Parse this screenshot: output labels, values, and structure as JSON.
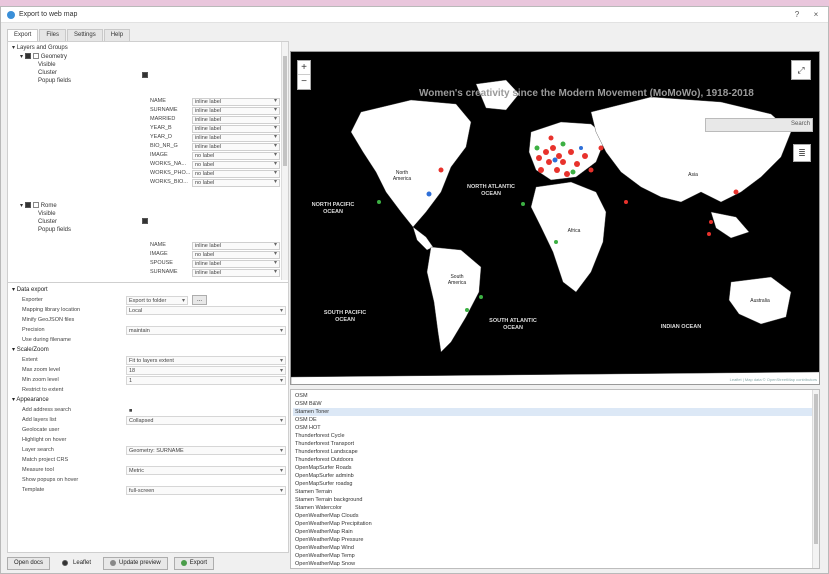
{
  "window": {
    "title": "Export to web map",
    "help_btn": "?",
    "close_btn": "×"
  },
  "tabs": [
    {
      "label": "Export"
    },
    {
      "label": "Files"
    },
    {
      "label": "Settings"
    },
    {
      "label": "Help"
    }
  ],
  "layers_tree": {
    "header": "Layers and Groups",
    "layer1": {
      "name": "Geometry",
      "options": [
        "Visible",
        "Cluster",
        "Popup fields"
      ],
      "fields": [
        {
          "name": "NAME",
          "value": "inline label"
        },
        {
          "name": "SURNAME",
          "value": "inline label"
        },
        {
          "name": "MARRIED",
          "value": "inline label"
        },
        {
          "name": "YEAR_B",
          "value": "inline label"
        },
        {
          "name": "YEAR_D",
          "value": "inline label"
        },
        {
          "name": "BIO_NR_G",
          "value": "inline label"
        },
        {
          "name": "IMAGE",
          "value": "no label"
        },
        {
          "name": "WORKS_NA...",
          "value": "no label"
        },
        {
          "name": "WORKS_PHO...",
          "value": "no label"
        },
        {
          "name": "WORKS_BIO...",
          "value": "no label"
        }
      ]
    },
    "layer2": {
      "name": "Rome",
      "options": [
        "Visible",
        "Cluster",
        "Popup fields"
      ],
      "fields": [
        {
          "name": "NAME",
          "value": "inline label"
        },
        {
          "name": "IMAGE",
          "value": "no label"
        },
        {
          "name": "SPOUSE",
          "value": "inline label"
        },
        {
          "name": "SURNAME",
          "value": "inline label"
        }
      ]
    }
  },
  "properties": {
    "data_export": {
      "header": "Data export",
      "rows": [
        {
          "name": "Exporter",
          "value": "Export to folder"
        },
        {
          "name": "Mapping library location",
          "value": "Local"
        },
        {
          "name": "Minify GeoJSON files",
          "value": ""
        },
        {
          "name": "Precision",
          "value": "maintain"
        },
        {
          "name": "Use during filename",
          "value": ""
        }
      ],
      "browse_btn": "..."
    },
    "scale_zoom": {
      "header": "Scale/Zoom",
      "rows": [
        {
          "name": "Extent",
          "value": "Fit to layers extent"
        },
        {
          "name": "Max zoom level",
          "value": "18"
        },
        {
          "name": "Min zoom level",
          "value": "1"
        },
        {
          "name": "Restrict to extent",
          "value": ""
        }
      ]
    },
    "appearance": {
      "header": "Appearance",
      "rows": [
        {
          "name": "Add address search",
          "value": "■"
        },
        {
          "name": "Add layers list",
          "value": "Collapsed"
        },
        {
          "name": "Geolocate user",
          "value": ""
        },
        {
          "name": "Highlight on hover",
          "value": ""
        },
        {
          "name": "Layer search",
          "value": "Geometry: SURNAME"
        },
        {
          "name": "Match project CRS",
          "value": ""
        },
        {
          "name": "Measure tool",
          "value": "Metric"
        },
        {
          "name": "Show popups on hover",
          "value": ""
        },
        {
          "name": "Template",
          "value": "full-screen"
        }
      ]
    }
  },
  "buttons": {
    "open_docs": "Open docs",
    "update_label": "Leaflet",
    "update_preview": "Update preview",
    "export": "Export"
  },
  "map": {
    "title": "Women's creativity since the Modern Movement (MoMoWo), 1918-2018",
    "search_label": "Search",
    "zoom_in": "+",
    "zoom_out": "−",
    "ocean_labels": [
      {
        "text": "NORTH PACIFIC OCEAN"
      },
      {
        "text": "NORTH ATLANTIC OCEAN"
      },
      {
        "text": "SOUTH PACIFIC OCEAN"
      },
      {
        "text": "SOUTH ATLANTIC OCEAN"
      },
      {
        "text": "INDIAN OCEAN"
      }
    ],
    "continent_labels": [
      {
        "text": "North America"
      },
      {
        "text": "Africa"
      },
      {
        "text": "South America"
      },
      {
        "text": "Asia"
      },
      {
        "text": "Australia"
      }
    ],
    "attribution": "Leaflet | Map data © OpenStreetMap contributors"
  },
  "basemaps": [
    "OSM",
    "OSM B&W",
    "Stamen Toner",
    "OSM DE",
    "OSM HOT",
    "Thunderforest Cycle",
    "Thunderforest Transport",
    "Thunderforest Landscape",
    "Thunderforest Outdoors",
    "OpenMapSurfer Roads",
    "OpenMapSurfer adminb",
    "OpenMapSurfer roadsg",
    "Stamen Terrain",
    "Stamen Terrain background",
    "Stamen Watercolor",
    "OpenWeatherMap Clouds",
    "OpenWeatherMap Precipitation",
    "OpenWeatherMap Rain",
    "OpenWeatherMap Pressure",
    "OpenWeatherMap Wind",
    "OpenWeatherMap Temp",
    "OpenWeatherMap Snow"
  ],
  "colors": {
    "marker_primary": "#e8322c",
    "marker_secondary": "#3cb043",
    "marker_tertiary": "#2e6fd8",
    "land": "#ffffff",
    "water": "#000000"
  }
}
